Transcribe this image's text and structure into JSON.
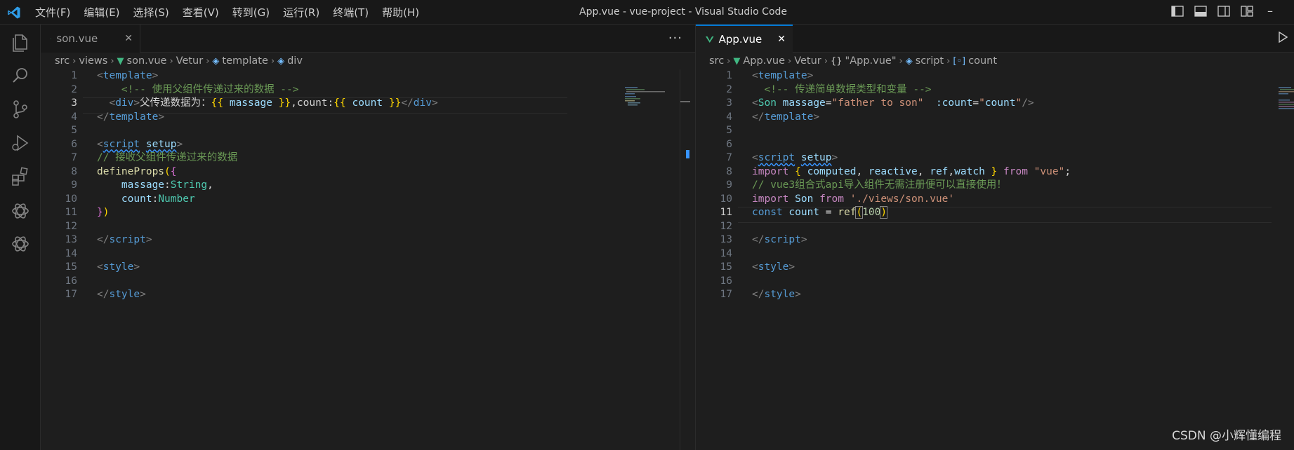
{
  "app": {
    "title": "App.vue - vue-project - Visual Studio Code",
    "menu": [
      "文件(F)",
      "编辑(E)",
      "选择(S)",
      "查看(V)",
      "转到(G)",
      "运行(R)",
      "终端(T)",
      "帮助(H)"
    ],
    "minimize": "–"
  },
  "activity_bar": [
    "explorer-icon",
    "search-icon",
    "source-control-icon",
    "run-debug-icon",
    "extensions-icon",
    "chatgpt-icon",
    "chatgpt-icon"
  ],
  "left": {
    "tab": {
      "label": "son.vue",
      "close": "✕"
    },
    "more": "···",
    "breadcrumb": [
      "src",
      "views",
      "son.vue",
      "Vetur",
      "template",
      "div"
    ],
    "current_line": 3,
    "lines": [
      [
        [
          "t-tag",
          "<"
        ],
        [
          "t-tagname",
          "template"
        ],
        [
          "t-tag",
          ">"
        ]
      ],
      [
        [
          "t-text",
          "    "
        ],
        [
          "t-comment",
          "<!-- 使用父组件传递过来的数据 -->"
        ]
      ],
      [
        [
          "t-text",
          "  "
        ],
        [
          "t-tag",
          "<"
        ],
        [
          "t-tagname",
          "div"
        ],
        [
          "t-tag",
          ">"
        ],
        [
          "t-text",
          "父传递数据为："
        ],
        [
          "t-brace",
          "{{"
        ],
        [
          "t-var",
          " massage "
        ],
        [
          "t-brace",
          "}}"
        ],
        [
          "t-text",
          ",count:"
        ],
        [
          "t-brace",
          "{{"
        ],
        [
          "t-var",
          " count "
        ],
        [
          "t-brace",
          "}}"
        ],
        [
          "t-tag",
          "</"
        ],
        [
          "t-tagname",
          "div"
        ],
        [
          "t-tag",
          ">"
        ]
      ],
      [
        [
          "t-tag",
          "</"
        ],
        [
          "t-tagname",
          "template"
        ],
        [
          "t-tag",
          ">"
        ]
      ],
      [],
      [
        [
          "t-tag",
          "<"
        ],
        [
          "t-tagname squig",
          "script"
        ],
        [
          "t-text",
          " "
        ],
        [
          "t-var squig",
          "setup"
        ],
        [
          "t-tag",
          ">"
        ]
      ],
      [
        [
          "t-comment",
          "// 接收父组件传递过来的数据"
        ]
      ],
      [
        [
          "t-func",
          "defineProps"
        ],
        [
          "t-brace",
          "("
        ],
        [
          "t-paren",
          "{"
        ]
      ],
      [
        [
          "t-text",
          "    "
        ],
        [
          "t-var",
          "massage"
        ],
        [
          "t-text",
          ":"
        ],
        [
          "t-type",
          "String"
        ],
        [
          "t-text",
          ","
        ]
      ],
      [
        [
          "t-text",
          "    "
        ],
        [
          "t-var",
          "count"
        ],
        [
          "t-text",
          ":"
        ],
        [
          "t-type",
          "Number"
        ]
      ],
      [
        [
          "t-paren",
          "}"
        ],
        [
          "t-brace",
          ")"
        ]
      ],
      [],
      [
        [
          "t-tag",
          "</"
        ],
        [
          "t-tagname",
          "script"
        ],
        [
          "t-tag",
          ">"
        ]
      ],
      [],
      [
        [
          "t-tag",
          "<"
        ],
        [
          "t-tagname",
          "style"
        ],
        [
          "t-tag",
          ">"
        ]
      ],
      [],
      [
        [
          "t-tag",
          "</"
        ],
        [
          "t-tagname",
          "style"
        ],
        [
          "t-tag",
          ">"
        ]
      ]
    ]
  },
  "right": {
    "tab": {
      "label": "App.vue",
      "close": "✕"
    },
    "breadcrumb": [
      "src",
      "App.vue",
      "Vetur",
      "\"App.vue\"",
      "script",
      "count"
    ],
    "current_line": 11,
    "lines": [
      [
        [
          "t-tag",
          "<"
        ],
        [
          "t-tagname",
          "template"
        ],
        [
          "t-tag",
          ">"
        ]
      ],
      [
        [
          "t-text",
          "  "
        ],
        [
          "t-comment",
          "<!-- 传递简单数据类型和变量 -->"
        ]
      ],
      [
        [
          "t-tag",
          "<"
        ],
        [
          "t-type",
          "Son"
        ],
        [
          "t-text",
          " "
        ],
        [
          "t-var",
          "massage"
        ],
        [
          "t-text",
          "="
        ],
        [
          "t-str",
          "\"father to son\""
        ],
        [
          "t-text",
          "  "
        ],
        [
          "t-var",
          ":count"
        ],
        [
          "t-text",
          "="
        ],
        [
          "t-str",
          "\""
        ],
        [
          "t-var",
          "count"
        ],
        [
          "t-str",
          "\""
        ],
        [
          "t-tag",
          "/>"
        ]
      ],
      [
        [
          "t-tag",
          "</"
        ],
        [
          "t-tagname",
          "template"
        ],
        [
          "t-tag",
          ">"
        ]
      ],
      [],
      [],
      [
        [
          "t-tag",
          "<"
        ],
        [
          "t-tagname squig",
          "script"
        ],
        [
          "t-text",
          " "
        ],
        [
          "t-var squig",
          "setup"
        ],
        [
          "t-tag",
          ">"
        ]
      ],
      [
        [
          "t-kw",
          "import"
        ],
        [
          "t-text",
          " "
        ],
        [
          "t-brace",
          "{"
        ],
        [
          "t-var",
          " computed"
        ],
        [
          "t-text",
          ", "
        ],
        [
          "t-var",
          "reactive"
        ],
        [
          "t-text",
          ", "
        ],
        [
          "t-var",
          "ref"
        ],
        [
          "t-text",
          ","
        ],
        [
          "t-var",
          "watch"
        ],
        [
          "t-text",
          " "
        ],
        [
          "t-brace",
          "}"
        ],
        [
          "t-text",
          " "
        ],
        [
          "t-kw",
          "from"
        ],
        [
          "t-text",
          " "
        ],
        [
          "t-str",
          "\"vue\""
        ],
        [
          "t-text",
          ";"
        ]
      ],
      [
        [
          "t-comment",
          "// vue3组合式api导入组件无需注册便可以直接使用！"
        ]
      ],
      [
        [
          "t-kw",
          "import"
        ],
        [
          "t-text",
          " "
        ],
        [
          "t-var",
          "Son"
        ],
        [
          "t-text",
          " "
        ],
        [
          "t-kw",
          "from"
        ],
        [
          "t-text",
          " "
        ],
        [
          "t-str",
          "'./views/son.vue'"
        ]
      ],
      [
        [
          "t-blue",
          "const"
        ],
        [
          "t-text",
          " "
        ],
        [
          "t-var",
          "count"
        ],
        [
          "t-text",
          " = "
        ],
        [
          "t-func",
          "ref"
        ],
        [
          "t-brace bracketbox",
          "("
        ],
        [
          "t-num",
          "100"
        ],
        [
          "t-brace bracketbox",
          ")"
        ]
      ],
      [],
      [
        [
          "t-tag",
          "</"
        ],
        [
          "t-tagname",
          "script"
        ],
        [
          "t-tag",
          ">"
        ]
      ],
      [],
      [
        [
          "t-tag",
          "<"
        ],
        [
          "t-tagname",
          "style"
        ],
        [
          "t-tag",
          ">"
        ]
      ],
      [],
      [
        [
          "t-tag",
          "</"
        ],
        [
          "t-tagname",
          "style"
        ],
        [
          "t-tag",
          ">"
        ]
      ]
    ]
  },
  "watermark": "CSDN @小辉懂编程"
}
